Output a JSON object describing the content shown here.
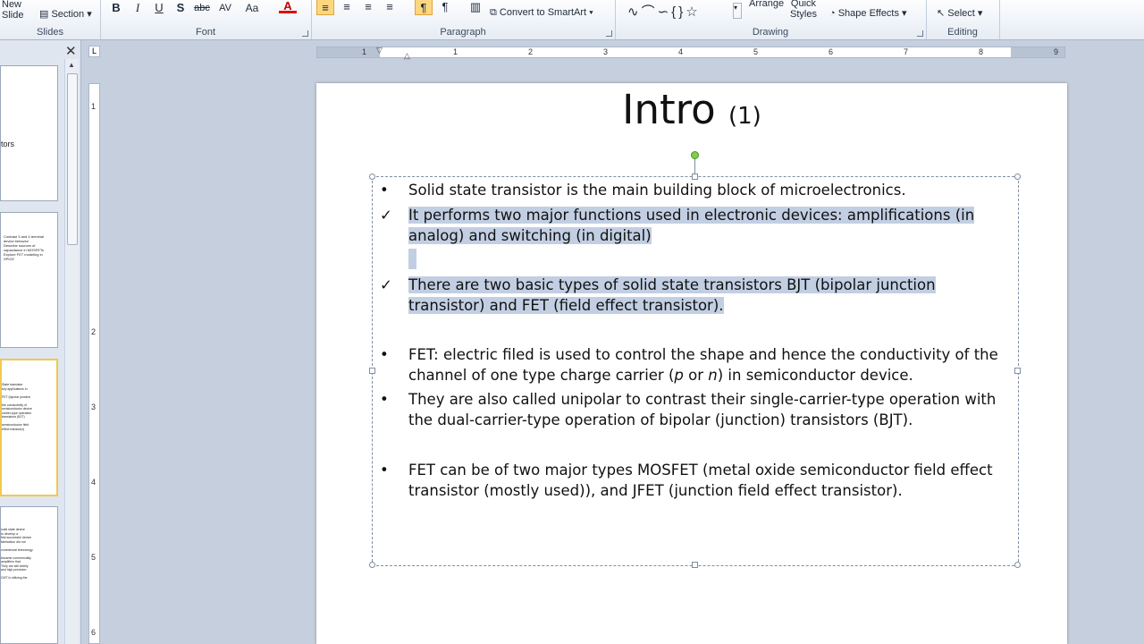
{
  "ribbon": {
    "slides_group": {
      "new_slide_label": "New\nSlide",
      "section_label": "Section",
      "group_label": "Slides"
    },
    "font_group": {
      "group_label": "Font",
      "bold": "B",
      "italic": "I",
      "underline": "U",
      "shadow": "S",
      "strike": "abc",
      "spacing": "AV",
      "case": "Aa",
      "color": "A"
    },
    "paragraph_group": {
      "group_label": "Paragraph",
      "smartart_label": "Convert to SmartArt"
    },
    "drawing_group": {
      "group_label": "Drawing",
      "arrange_label": "Arrange",
      "quick_styles_label": "Quick\nStyles",
      "shape_effects_label": "Shape Effects"
    },
    "editing_group": {
      "group_label": "Editing",
      "select_label": "Select"
    }
  },
  "slide_panel": {
    "thumbs": [
      {
        "text": "tors"
      },
      {
        "text": "Contrast 3 and 4 terminal device behavior\nDescribe sources of capacitance in MOSFETs\nExplore FET modeling in SPICE"
      },
      {
        "text": "State transistor\nkey applications in\n\nFET (bipolar junction\n\nthe conductivity of\nsemiconductor device\ncarrier-type operation\ntransistors (BJT)\n\nsemiconductor field\neffect transistor)"
      },
      {
        "text": "solid state device\nto develop a\nfirst successful device\nfabrication did not\n\ncommercial technology\n\nbecame commercially\namplifiers that\nThey are still widely\nand high precision\n\nCMT is utilizing the"
      }
    ]
  },
  "rulers": {
    "h_labels": [
      "1",
      "1",
      "2",
      "3",
      "4",
      "5",
      "6",
      "7",
      "8",
      "9"
    ],
    "v_labels": [
      "1",
      "2",
      "3",
      "4",
      "5",
      "6"
    ],
    "tab_selector": "L"
  },
  "slide": {
    "title_main": "Intro",
    "title_sub": "(1)",
    "bullets": [
      {
        "marker": "•",
        "text": "Solid state transistor is the main building block of microelectronics.",
        "highlighted": false
      },
      {
        "marker": "✓",
        "text": "It performs two major functions used in electronic devices: amplifications (in analog) and switching (in digital)",
        "highlighted": true
      },
      {
        "marker": "✓",
        "text": "There are two basic types of solid state transistors BJT (bipolar junction transistor) and FET (field effect transistor).",
        "highlighted": true
      },
      {
        "marker": "•",
        "text_before": "FET: electric filed is used to control the shape and hence the conductivity of the channel of one type charge carrier (",
        "italic_p": "p",
        "text_or": " or ",
        "italic_n": "n",
        "text_after": ")  in semiconductor device.",
        "highlighted": false
      },
      {
        "marker": "•",
        "text": "They are also called unipolar to contrast their single-carrier-type operation with the dual-carrier-type operation of bipolar (junction) transistors (BJT).",
        "highlighted": false
      },
      {
        "marker": "•",
        "text": "FET can be of two major types MOSFET (metal oxide semiconductor field effect transistor (mostly used)), and JFET (junction field effect transistor).",
        "highlighted": false
      }
    ]
  }
}
